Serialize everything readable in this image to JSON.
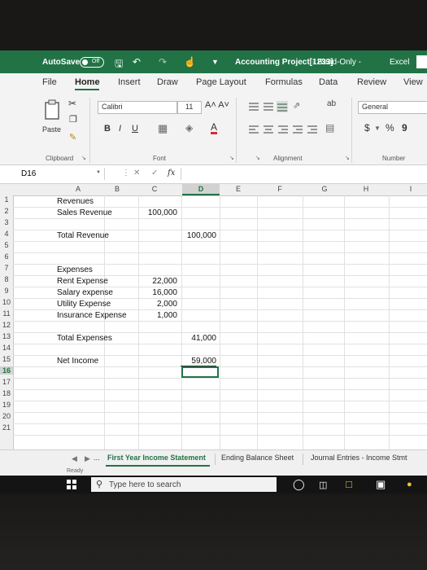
{
  "titlebar": {
    "autosave_label": "AutoSave",
    "autosave_state": "Off",
    "document_title": "Accounting Project[1233]",
    "document_status": "-  Read-Only  -",
    "app_name": "Excel"
  },
  "menu": {
    "items": [
      "File",
      "Home",
      "Insert",
      "Draw",
      "Page Layout",
      "Formulas",
      "Data",
      "Review",
      "View"
    ],
    "active": "Home"
  },
  "ribbon": {
    "paste_label": "Paste",
    "font_name": "Calibri",
    "font_size": "11",
    "bold": "B",
    "italic": "I",
    "underline": "U",
    "grow_font": "A˄ A˅",
    "font_color": "A",
    "number_format": "General",
    "currency": "$",
    "percent": "%",
    "comma": "9",
    "groups": {
      "clipboard": "Clipboard",
      "font": "Font",
      "alignment": "Alignment",
      "number": "Number"
    }
  },
  "formula_bar": {
    "name_box": "D16",
    "fx": "fx",
    "content": ""
  },
  "grid": {
    "columns": [
      "A",
      "B",
      "C",
      "D",
      "E",
      "F",
      "G",
      "H",
      "I"
    ],
    "selected_column": "D",
    "rows": [
      "1",
      "2",
      "3",
      "4",
      "5",
      "6",
      "7",
      "8",
      "9",
      "10",
      "11",
      "12",
      "13",
      "14",
      "15",
      "16",
      "17",
      "18",
      "19",
      "20",
      "21"
    ],
    "selected_row": "16",
    "cells": {
      "a1": "Revenues",
      "a2": "Sales Revenue",
      "c2": "100,000",
      "a4": "Total Revenue",
      "d4": "100,000",
      "a7": "Expenses",
      "a8": "Rent Expense",
      "c8": "22,000",
      "a9": "Salary expense",
      "c9": "16,000",
      "a10": "Utility Expense",
      "c10": "2,000",
      "a11": "Insurance Expense",
      "c11": "1,000",
      "a13": "Total Expenses",
      "d13": "41,000",
      "a15": "Net Income",
      "d15": "59,000"
    }
  },
  "sheets": {
    "tabs": [
      "First Year Income Statement",
      "Ending Balance Sheet",
      "Journal Entries - Income Stmt"
    ],
    "active": "First Year Income Statement",
    "overflow": "..."
  },
  "status": "Ready",
  "taskbar": {
    "search_placeholder": "Type here to search"
  }
}
